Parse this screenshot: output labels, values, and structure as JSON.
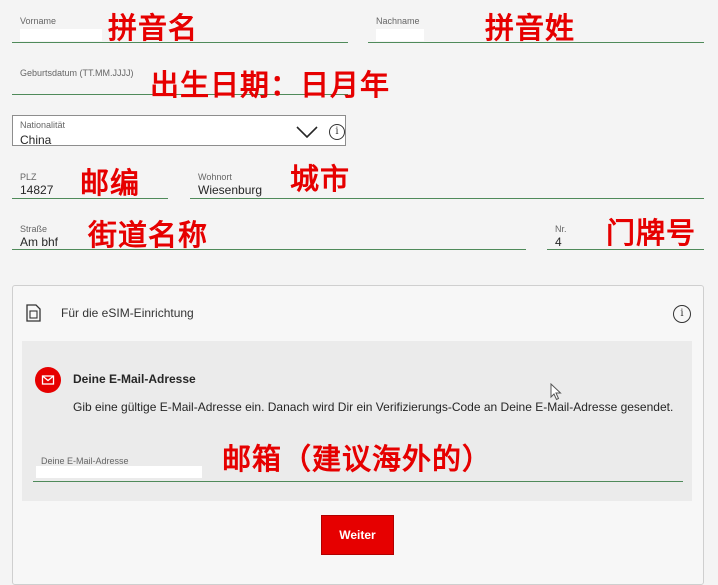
{
  "form": {
    "vorname": {
      "label": "Vorname",
      "value": ""
    },
    "nachname": {
      "label": "Nachname",
      "value": ""
    },
    "geburtsdatum": {
      "label": "Geburtsdatum (TT.MM.JJJJ)",
      "value": ""
    },
    "nationalitaet": {
      "label": "Nationalität",
      "value": "China"
    },
    "plz": {
      "label": "PLZ",
      "value": "14827"
    },
    "wohnort": {
      "label": "Wohnort",
      "value": "Wiesenburg"
    },
    "strasse": {
      "label": "Straße",
      "value": "Am bhf"
    },
    "nr": {
      "label": "Nr.",
      "value": "4"
    }
  },
  "annotations": {
    "vorname": "拼音名",
    "nachname": "拼音姓",
    "geburtsdatum": "出生日期：日月年",
    "plz": "邮编",
    "wohnort": "城市",
    "strasse": "街道名称",
    "nr": "门牌号",
    "email": "邮箱（建议海外的）"
  },
  "esim": {
    "title": "Für die eSIM-Einrichtung",
    "email_heading": "Deine E-Mail-Adresse",
    "email_description": "Gib eine gültige E-Mail-Adresse ein. Danach wird Dir ein Verifizierungs-Code an Deine E-Mail-Adresse gesendet.",
    "email_label": "Deine E-Mail-Adresse",
    "email_value": ""
  },
  "buttons": {
    "weiter": "Weiter"
  },
  "icons": {
    "dropdown": "chevron-down-icon",
    "info": "info-icon",
    "sim": "sim-card-icon",
    "mail": "mail-icon",
    "cursor": "mouse-cursor-icon"
  },
  "colors": {
    "accent": "#e60000",
    "underline": "#4f8a5a"
  }
}
